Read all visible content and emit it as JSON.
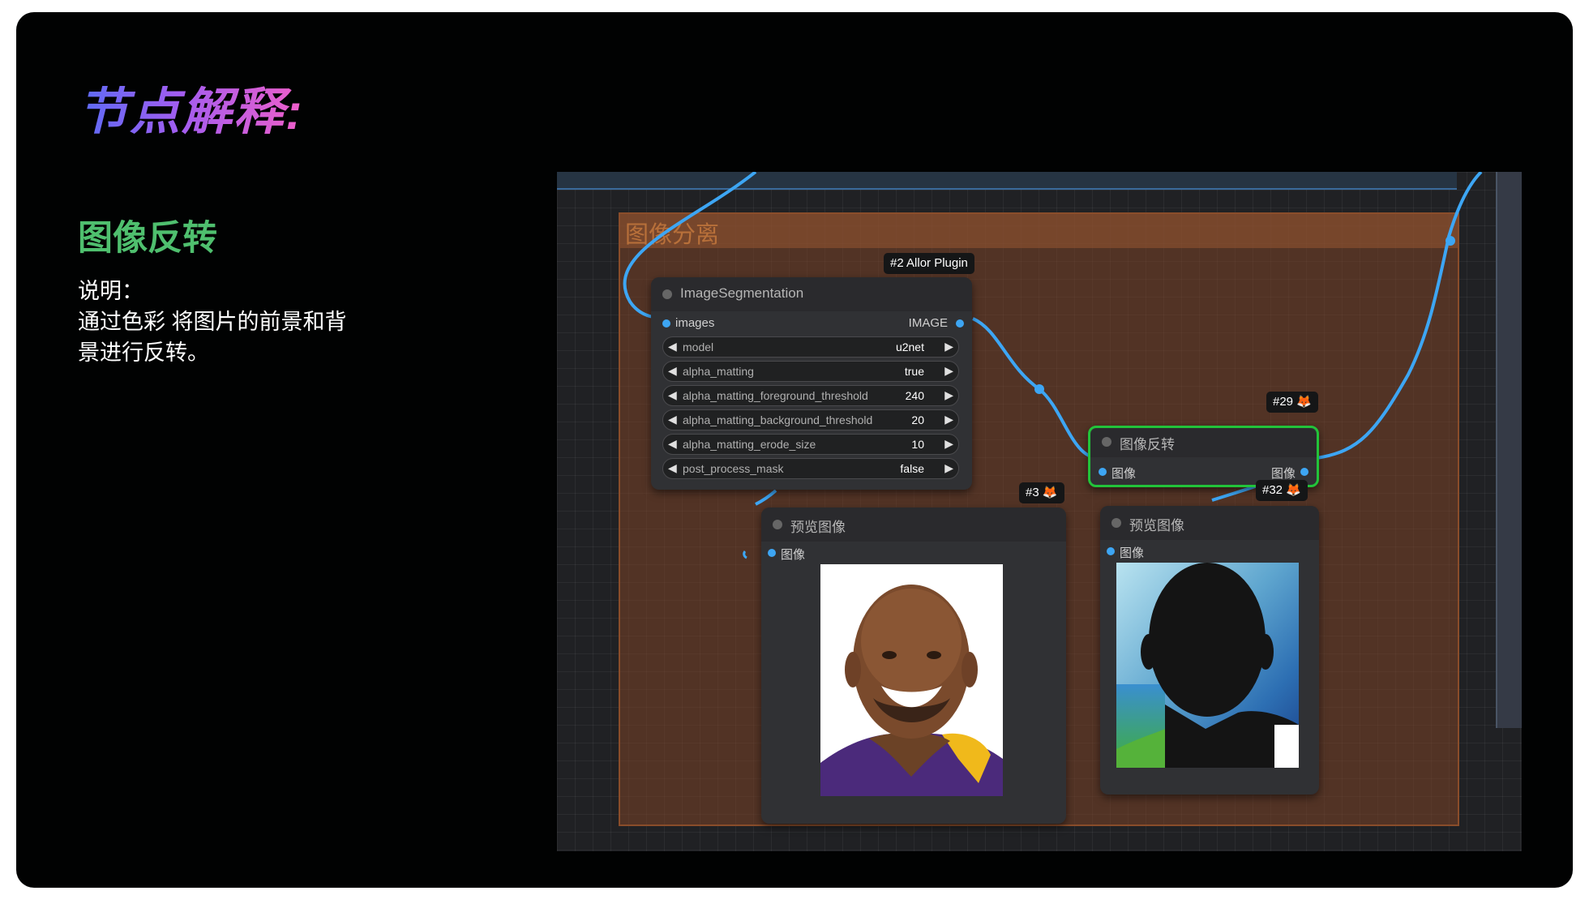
{
  "slide": {
    "title": "节点解释:",
    "subtitle": "图像反转",
    "description_label": "说明：",
    "description_lines": [
      "通过色彩 将图片的前景和背",
      "景进行反转。"
    ]
  },
  "canvas": {
    "group_title": "图像分离",
    "nodes": {
      "segmentation": {
        "tag": "#2 Allor Plugin",
        "title": "ImageSegmentation",
        "input_label": "images",
        "output_label": "IMAGE",
        "widgets": [
          {
            "name": "model",
            "value": "u2net"
          },
          {
            "name": "alpha_matting",
            "value": "true"
          },
          {
            "name": "alpha_matting_foreground_threshold",
            "value": "240"
          },
          {
            "name": "alpha_matting_background_threshold",
            "value": "20"
          },
          {
            "name": "alpha_matting_erode_size",
            "value": "10"
          },
          {
            "name": "post_process_mask",
            "value": "false"
          }
        ]
      },
      "invert": {
        "tag": "#29 🦊",
        "title": "图像反转",
        "input_label": "图像",
        "output_label": "图像"
      },
      "preview1": {
        "tag": "#3 🦊",
        "title": "预览图像",
        "input_label": "图像"
      },
      "preview2": {
        "tag": "#32 🦊",
        "title": "预览图像",
        "input_label": "图像"
      }
    }
  },
  "colors": {
    "wire": "#3da6f4",
    "selected": "#22c33a",
    "title_green": "#4fbf6e"
  }
}
